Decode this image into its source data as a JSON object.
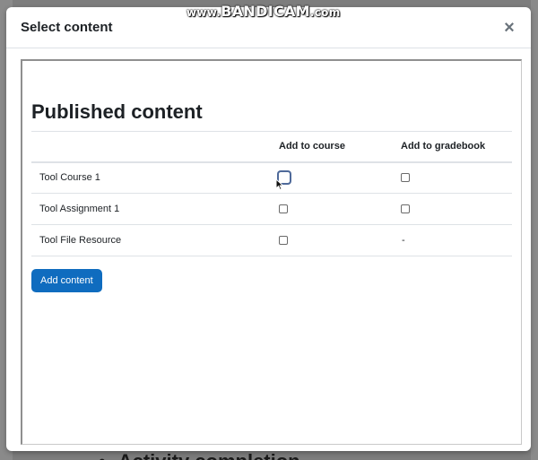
{
  "modal": {
    "title": "Select content",
    "close_label": "×"
  },
  "content": {
    "heading": "Published content",
    "columns": [
      "",
      "Add to course",
      "Add to gradebook"
    ],
    "rows": [
      {
        "name": "Tool Course 1",
        "gradebook": "checkbox"
      },
      {
        "name": "Tool Assignment 1",
        "gradebook": "checkbox"
      },
      {
        "name": "Tool File Resource",
        "gradebook": "-"
      }
    ],
    "add_button": "Add content"
  },
  "background": {
    "partial_heading": "Activity completion"
  },
  "watermark": {
    "prefix": "www.",
    "brand": "BANDICAM",
    "suffix": ".com"
  }
}
